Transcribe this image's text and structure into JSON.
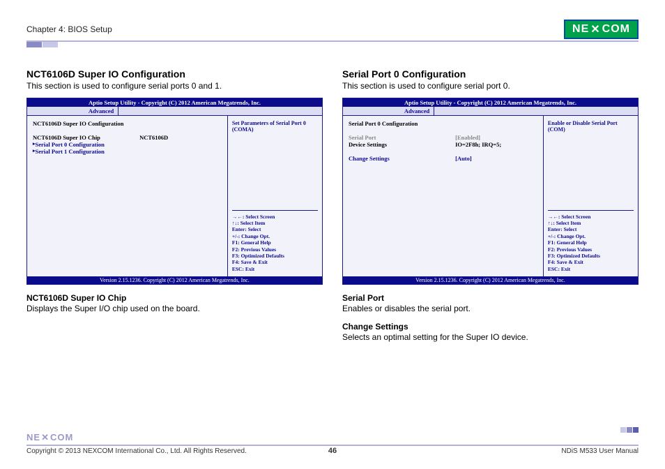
{
  "header": {
    "chapter": "Chapter 4: BIOS Setup",
    "logo_text": "NE COM"
  },
  "left": {
    "title": "NCT6106D Super IO Configuration",
    "subtitle": "This section is used to configure serial ports 0 and 1.",
    "bios": {
      "title": "Aptio Setup Utility - Copyright (C) 2012 American Megatrends, Inc.",
      "tab": "Advanced",
      "rows": [
        {
          "label": "NCT6106D Super IO Configuration",
          "value": "",
          "cls": "black"
        },
        {
          "label": "",
          "value": "",
          "cls": ""
        },
        {
          "label": "NCT6106D Super IO Chip",
          "value": "NCT6106D",
          "cls": "black"
        },
        {
          "label": "Serial Port 0 Configuration",
          "value": "",
          "cls": "arrow"
        },
        {
          "label": "Serial Port 1 Configuration",
          "value": "",
          "cls": "arrow"
        }
      ],
      "help": "Set Parameters of Serial Port 0 (COMA)",
      "keys": [
        "→←: Select Screen",
        "↑↓: Select Item",
        "Enter: Select",
        "+/-: Change Opt.",
        "F1: General Help",
        "F2: Previous Values",
        "F3: Optimized Defaults",
        "F4: Save & Exit",
        "ESC: Exit"
      ],
      "footer": "Version 2.15.1236. Copyright (C) 2012 American Megatrends, Inc."
    },
    "desc1_h": "NCT6106D Super IO Chip",
    "desc1_p": "Displays the Super I/O chip used on the board."
  },
  "right": {
    "title": "Serial Port 0 Configuration",
    "subtitle": "This section is used to configure serial port 0.",
    "bios": {
      "title": "Aptio Setup Utility - Copyright (C) 2012 American Megatrends, Inc.",
      "tab": "Advanced",
      "rows": [
        {
          "label": "Serial Port 0 Configuration",
          "value": "",
          "cls": "black"
        },
        {
          "label": "",
          "value": "",
          "cls": ""
        },
        {
          "label": "Serial Port",
          "value": "[Enabled]",
          "cls": "gray"
        },
        {
          "label": "Device Settings",
          "value": "IO=2F8h; IRQ=5;",
          "cls": "black"
        },
        {
          "label": "",
          "value": "",
          "cls": ""
        },
        {
          "label": "Change Settings",
          "value": "[Auto]",
          "cls": ""
        }
      ],
      "help": "Enable or Disable Serial Port (COM)",
      "keys": [
        "→←: Select Screen",
        "↑↓: Select Item",
        "Enter: Select",
        "+/-: Change Opt.",
        "F1: General Help",
        "F2: Previous Values",
        "F3: Optimized Defaults",
        "F4: Save & Exit",
        "ESC: Exit"
      ],
      "footer": "Version 2.15.1236. Copyright (C) 2012 American Megatrends, Inc."
    },
    "desc1_h": "Serial Port",
    "desc1_p": "Enables or disables the serial port.",
    "desc2_h": "Change Settings",
    "desc2_p": "Selects an optimal setting for the Super IO device."
  },
  "footer": {
    "logo": "NE COM",
    "copyright": "Copyright © 2013 NEXCOM International Co., Ltd. All Rights Reserved.",
    "page": "46",
    "manual": "NDiS M533 User Manual"
  }
}
